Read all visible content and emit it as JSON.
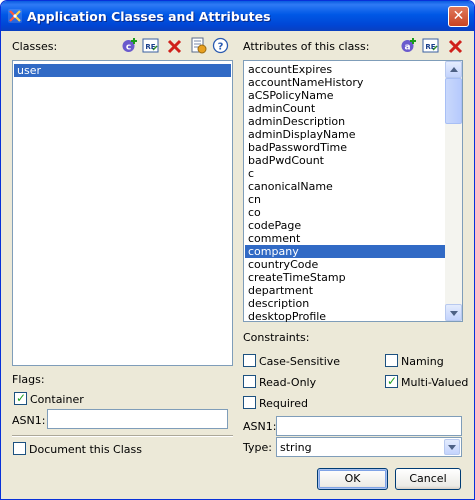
{
  "window": {
    "title": "Application Classes and Attributes"
  },
  "classes": {
    "label": "Classes:",
    "items": [
      {
        "label": "user",
        "selected": true
      }
    ],
    "tools": [
      "add-class-icon",
      "rename-icon",
      "delete-icon",
      "properties-icon",
      "help-icon"
    ]
  },
  "attributes": {
    "label": "Attributes of this class:",
    "tools": [
      "add-attribute-icon",
      "rename-icon",
      "delete-icon"
    ],
    "items": [
      "accountExpires",
      "accountNameHistory",
      "aCSPolicyName",
      "adminCount",
      "adminDescription",
      "adminDisplayName",
      "badPasswordTime",
      "badPwdCount",
      "c",
      "canonicalName",
      "cn",
      "co",
      "codePage",
      "comment",
      "company",
      "countryCode",
      "createTimeStamp",
      "department",
      "description",
      "desktopProfile"
    ],
    "selected": "company"
  },
  "flags": {
    "label": "Flags:",
    "container_label": "Container",
    "container_checked": true,
    "asn1_label": "ASN1:",
    "asn1_value": "",
    "document_label": "Document this Class",
    "document_checked": false
  },
  "constraints": {
    "label": "Constraints:",
    "case_sensitive_label": "Case-Sensitive",
    "case_sensitive_checked": false,
    "naming_label": "Naming",
    "naming_checked": false,
    "read_only_label": "Read-Only",
    "read_only_checked": false,
    "multi_valued_label": "Multi-Valued",
    "multi_valued_checked": true,
    "required_label": "Required",
    "required_checked": false,
    "asn1_label": "ASN1:",
    "asn1_value": "",
    "type_label": "Type:",
    "type_value": "string"
  },
  "buttons": {
    "ok": "OK",
    "cancel": "Cancel"
  },
  "colors": {
    "selection": "#316ac5",
    "titlebar": "#0058e6",
    "dialog_bg": "#ece9d8"
  }
}
